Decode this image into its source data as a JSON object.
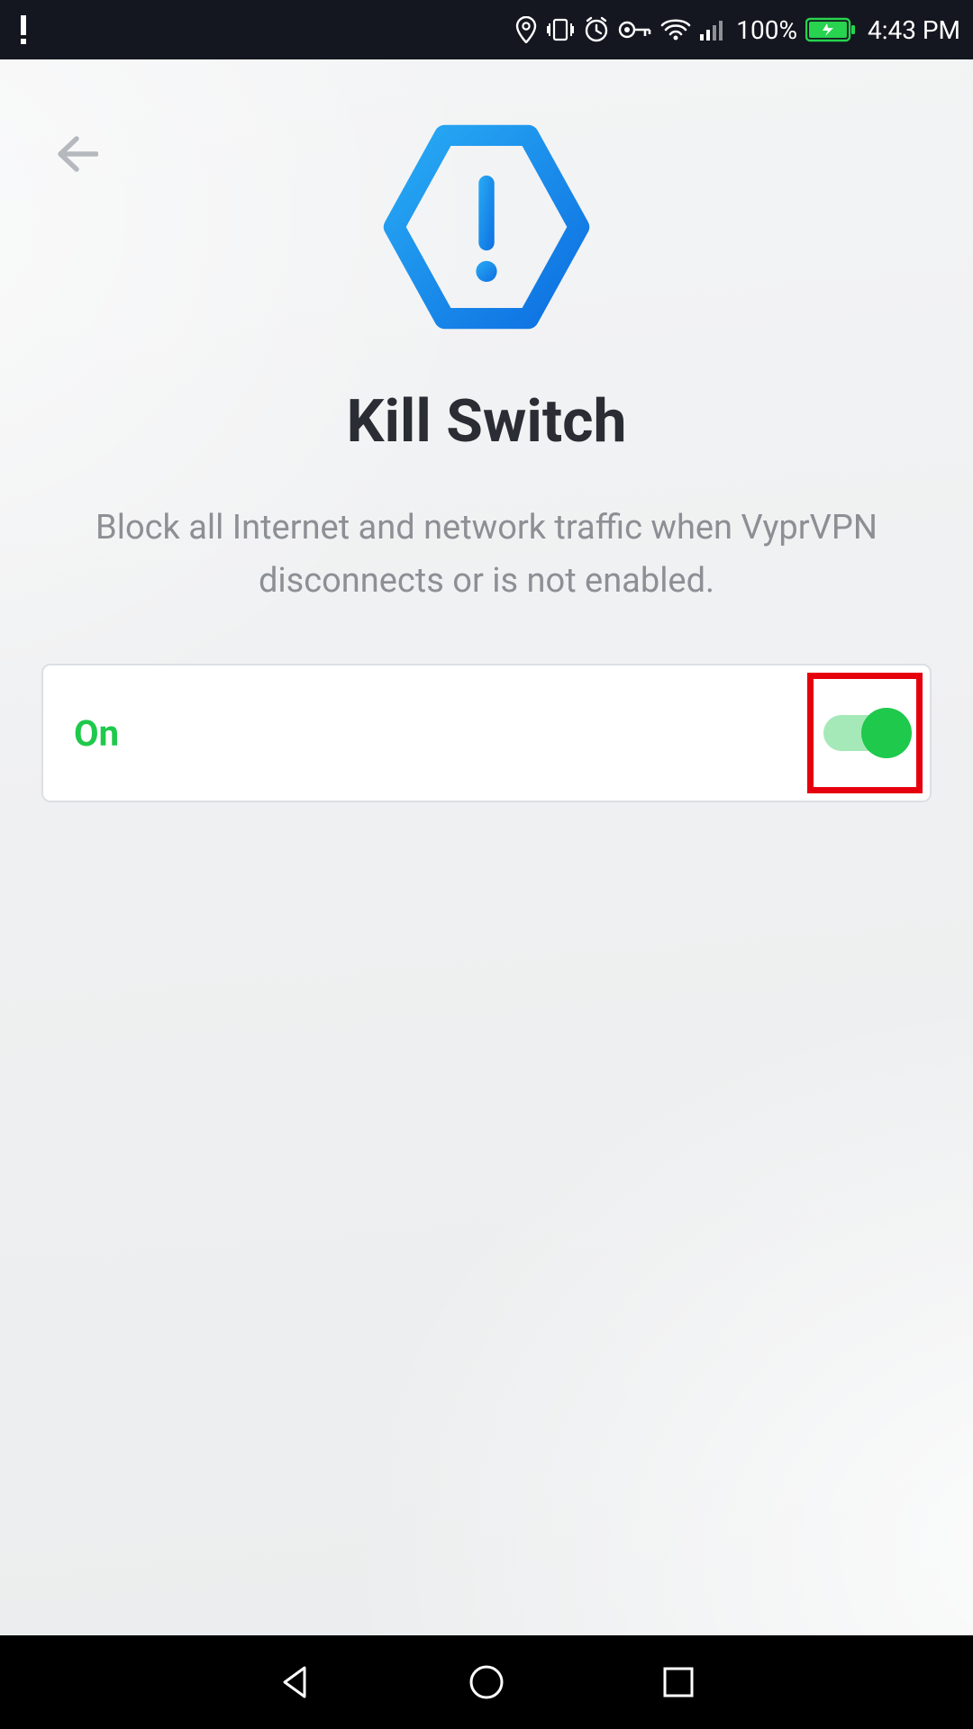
{
  "status_bar": {
    "battery_pct": "100%",
    "time": "4:43 PM"
  },
  "header": {
    "title": "Kill Switch",
    "subtitle": "Block all Internet and network traffic when VyprVPN disconnects or is not enabled."
  },
  "toggle": {
    "label": "On",
    "state": "on"
  },
  "colors": {
    "accent_green": "#1ec94b",
    "highlight_red": "#e6000e",
    "icon_blue_light": "#26a6f2",
    "icon_blue_dark": "#0f6fe0"
  }
}
